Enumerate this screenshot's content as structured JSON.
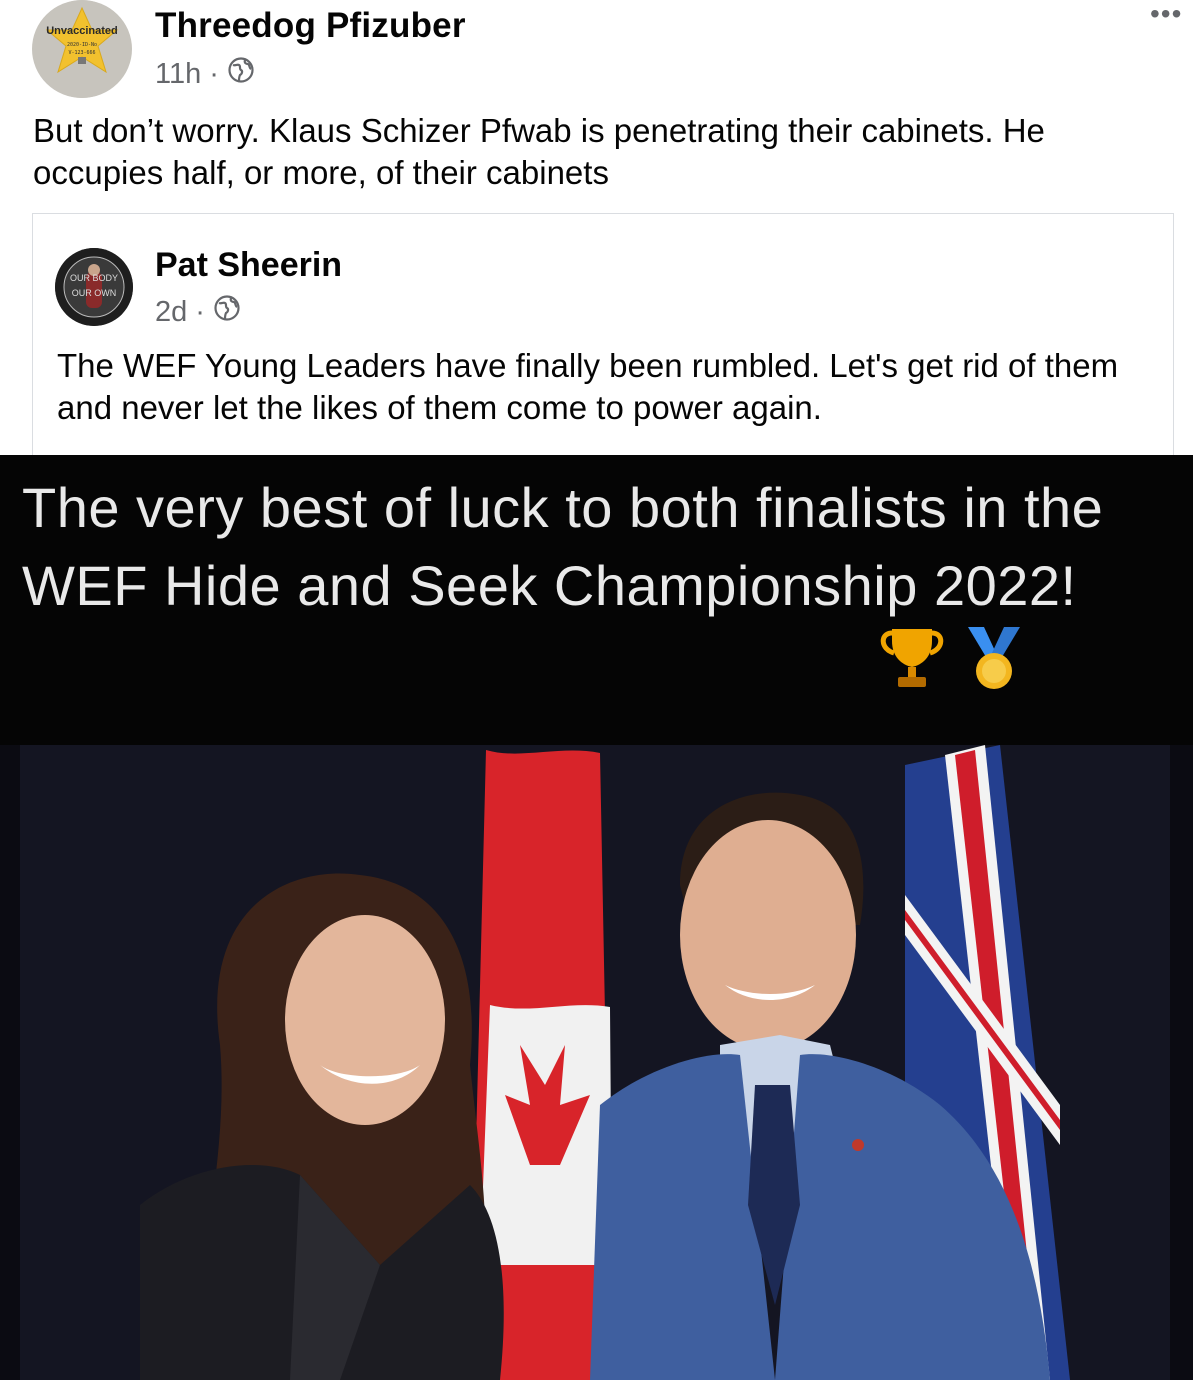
{
  "post": {
    "author": "Threedog Pfizuber",
    "time": "11h",
    "separator": "·",
    "audience_icon": "globe-icon",
    "text": "But don’t worry. Klaus Schizer Pfwab is penetrating their cabinets. He occupies half, or more, of their cabinets",
    "more_label": "•••"
  },
  "shared_post": {
    "author": "Pat Sheerin",
    "time": "2d",
    "separator": "·",
    "audience_icon": "globe-icon",
    "text": "The WEF Young Leaders have finally been rumbled. Let's get rid of them and never let the likes of them come to power again."
  },
  "meme": {
    "caption": "The very best of luck to both finalists in the WEF Hide and Seek Championship 2022!",
    "emoji": [
      "trophy-icon",
      "medal-icon"
    ]
  },
  "avatar1_badge": {
    "lines": [
      "Unvaccinated",
      "2020-ID-No",
      "V-123-666"
    ]
  },
  "avatar2_badge": {
    "lines": [
      "OUR BODY",
      "OUR OWN"
    ]
  },
  "colors": {
    "secondary_text": "#65676b",
    "border": "#dadde1",
    "meme_bg": "#050505",
    "badge_yellow": "#f2c12e"
  }
}
